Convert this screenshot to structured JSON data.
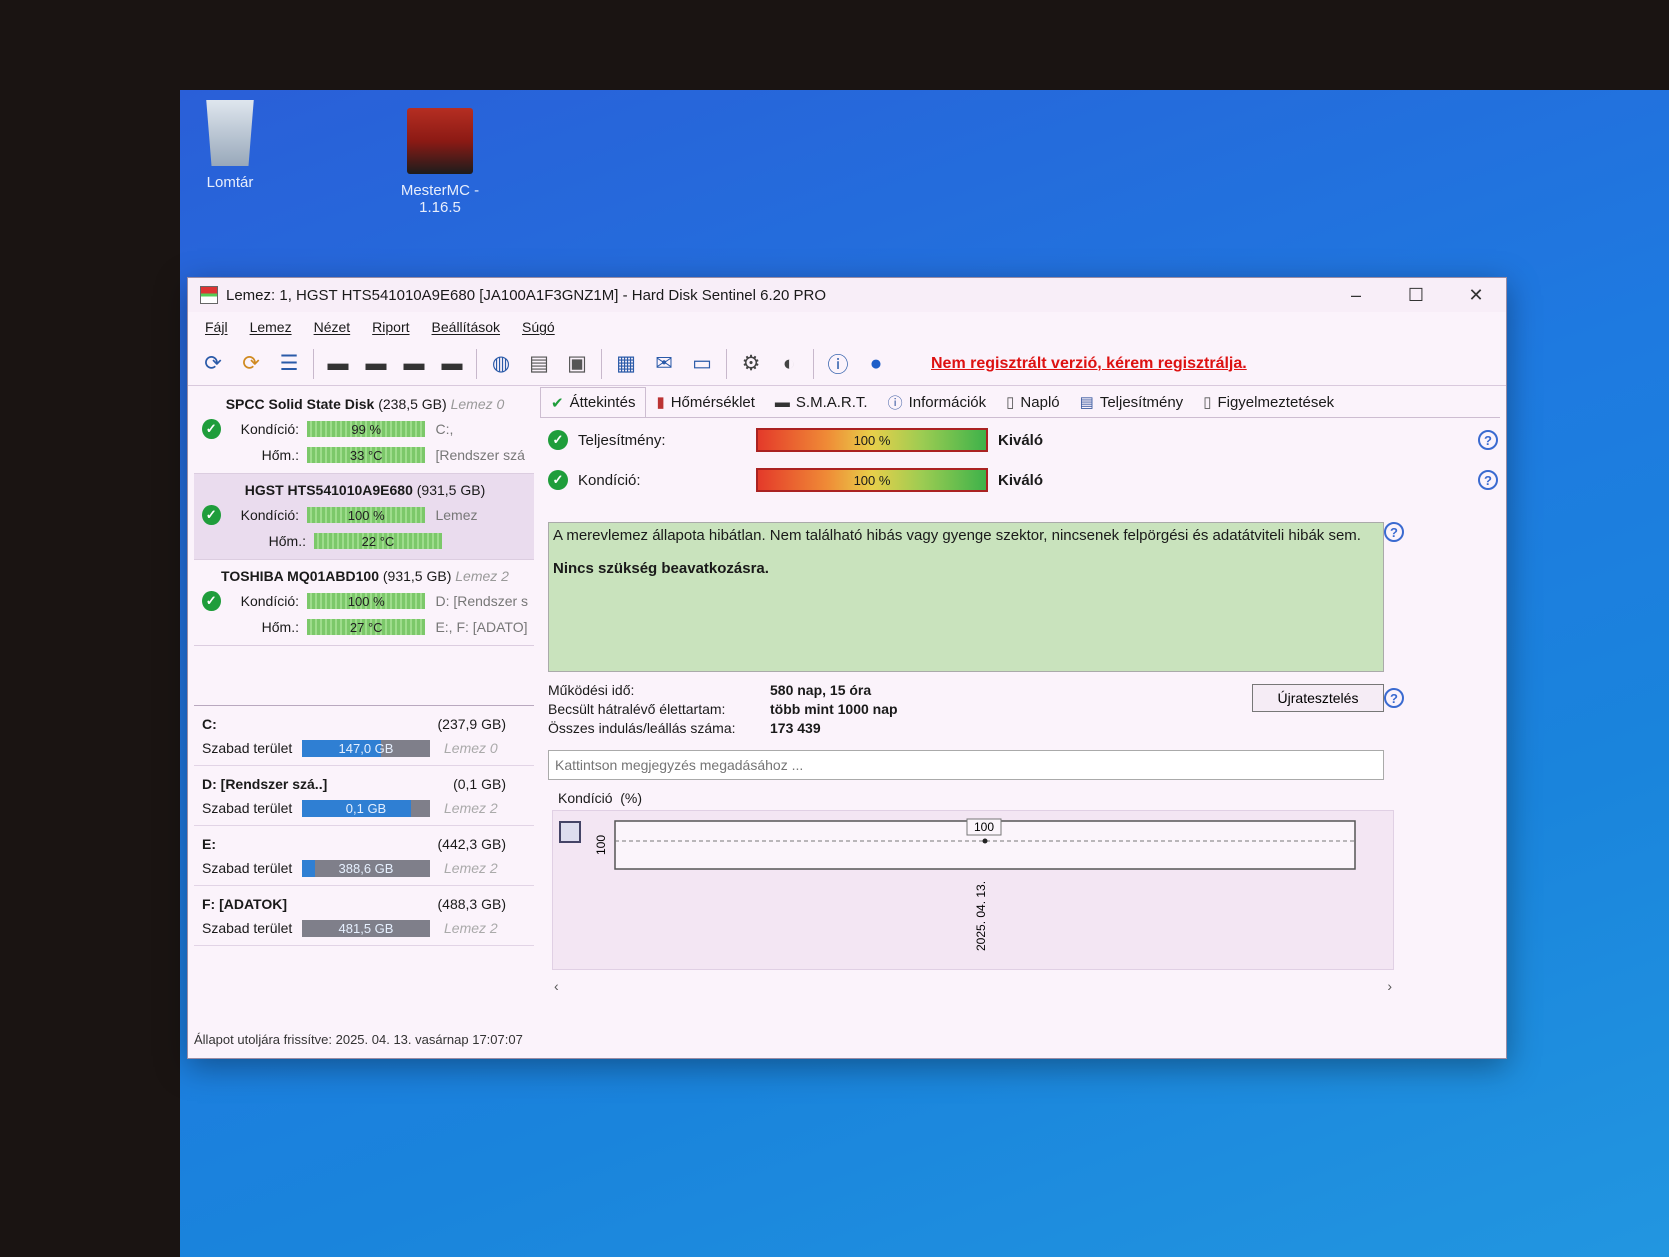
{
  "desktop": {
    "icons": [
      {
        "label": "Lomtár"
      },
      {
        "label": "MesterMC -\n1.16.5"
      }
    ],
    "background_color": "#1e7ae0"
  },
  "window": {
    "title": "Lemez: 1, HGST HTS541010A9E680 [JA100A1F3GNZ1M]  -  Hard Disk Sentinel 6.20 PRO",
    "controls": {
      "minimize": "–",
      "maximize": "☐",
      "close": "✕"
    }
  },
  "menu": [
    "Fájl",
    "Lemez",
    "Nézet",
    "Riport",
    "Beállítások",
    "Súgó"
  ],
  "toolbar": {
    "unregistered_text": "Nem regisztrált verzió, kérem regisztrálja."
  },
  "disks": [
    {
      "name": "SPCC Solid State Disk",
      "size": "(238,5 GB)",
      "disk_label": "Lemez 0",
      "condition_label": "Kondíció:",
      "condition": "99 %",
      "temp_label": "Hőm.:",
      "temp": "33 °C",
      "extra1": "C:,",
      "extra2": "[Rendszer szá"
    },
    {
      "name": "HGST HTS541010A9E680",
      "size": "(931,5 GB)",
      "disk_label": "",
      "condition_label": "Kondíció:",
      "condition": "100 %",
      "temp_label": "Hőm.:",
      "temp": "22 °C",
      "extra1": "Lemez",
      "extra2": ""
    },
    {
      "name": "TOSHIBA MQ01ABD100",
      "size": "(931,5 GB)",
      "disk_label": "Lemez 2",
      "condition_label": "Kondíció:",
      "condition": "100 %",
      "temp_label": "Hőm.:",
      "temp": "27 °C",
      "extra1": "D: [Rendszer s",
      "extra2": "E:, F: [ADATO]"
    }
  ],
  "volumes": [
    {
      "name": "C:",
      "size": "(237,9 GB)",
      "free_label": "Szabad terület",
      "free": "147,0 GB",
      "free_pct": 62,
      "disk": "Lemez 0"
    },
    {
      "name": "D: [Rendszer szá..]",
      "size": "(0,1 GB)",
      "free_label": "Szabad terület",
      "free": "0,1 GB",
      "free_pct": 85,
      "disk": "Lemez 2"
    },
    {
      "name": "E:",
      "size": "(442,3 GB)",
      "free_label": "Szabad terület",
      "free": "388,6 GB",
      "free_pct": 10,
      "disk": "Lemez 2"
    },
    {
      "name": "F: [ADATOK]",
      "size": "(488,3 GB)",
      "free_label": "Szabad terület",
      "free": "481,5 GB",
      "free_pct": 0,
      "disk": "Lemez 2"
    }
  ],
  "status": "Állapot utoljára frissítve: 2025. 04. 13. vasárnap 17:07:07",
  "tabs": [
    "Áttekintés",
    "Hőmérséklet",
    "S.M.A.R.T.",
    "Információk",
    "Napló",
    "Teljesítmény",
    "Figyelmeztetések"
  ],
  "overview": {
    "performance_label": "Teljesítmény:",
    "performance": "100 %",
    "performance_rating": "Kiváló",
    "condition_label": "Kondíció:",
    "condition": "100 %",
    "condition_rating": "Kiváló",
    "message": "A merevlemez állapota hibátlan. Nem található hibás vagy gyenge szektor, nincsenek felpörgési és adatátviteli hibák sem.",
    "message_bold": "Nincs szükség beavatkozásra.",
    "uptime_label": "Működési idő:",
    "uptime": "580 nap, 15 óra",
    "lifetime_label": "Becsült hátralévő élettartam:",
    "lifetime": "több mint 1000 nap",
    "startstop_label": "Összes indulás/leállás száma:",
    "startstop": "173 439",
    "retest_button": "Újratesztelés",
    "note_placeholder": "Kattintson megjegyzés megadásához ...",
    "chart_title": "Kondíció",
    "chart_unit": "(%)"
  },
  "chart_data": {
    "type": "line",
    "x": [
      "2025. 04. 13."
    ],
    "values": [
      100
    ],
    "ylabel": "100",
    "point_label": "100"
  }
}
